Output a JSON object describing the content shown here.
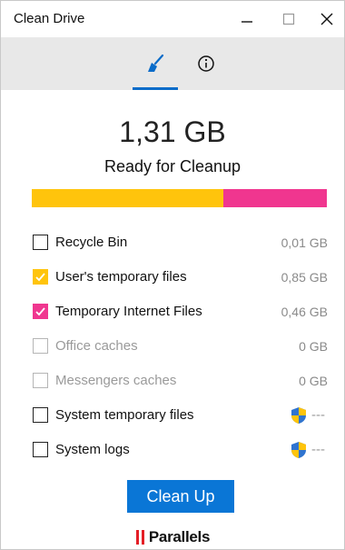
{
  "window": {
    "title": "Clean Drive"
  },
  "tabs": [
    {
      "name": "clean",
      "icon": "broom-icon",
      "active": true
    },
    {
      "name": "info",
      "icon": "info-icon",
      "active": false
    }
  ],
  "summary": {
    "total_size": "1,31 GB",
    "status": "Ready for Cleanup"
  },
  "usage_bar": {
    "segments": [
      {
        "color": "#ffc40c",
        "fraction": 0.649
      },
      {
        "color": "#f0368f",
        "fraction": 0.351
      }
    ]
  },
  "items": [
    {
      "label": "Recycle Bin",
      "value": "0,01 GB",
      "checked": false,
      "enabled": true
    },
    {
      "label": "User's temporary files",
      "value": "0,85 GB",
      "checked": true,
      "check_color": "#ffc40c",
      "enabled": true
    },
    {
      "label": "Temporary Internet Files",
      "value": "0,46 GB",
      "checked": true,
      "check_color": "#f0368f",
      "enabled": true
    },
    {
      "label": "Office caches",
      "value": "0 GB",
      "checked": false,
      "enabled": false
    },
    {
      "label": "Messengers caches",
      "value": "0 GB",
      "checked": false,
      "enabled": false
    },
    {
      "label": "System temporary files",
      "value": "---",
      "checked": false,
      "enabled": true,
      "icon": "admin-shield-icon"
    },
    {
      "label": "System logs",
      "value": "---",
      "checked": false,
      "enabled": true,
      "icon": "admin-shield-icon"
    }
  ],
  "actions": {
    "cleanup_label": "Clean Up"
  },
  "branding": {
    "name": "Parallels"
  },
  "colors": {
    "accent": "#0a76d6",
    "yellow": "#ffc40c",
    "pink": "#f0368f"
  }
}
